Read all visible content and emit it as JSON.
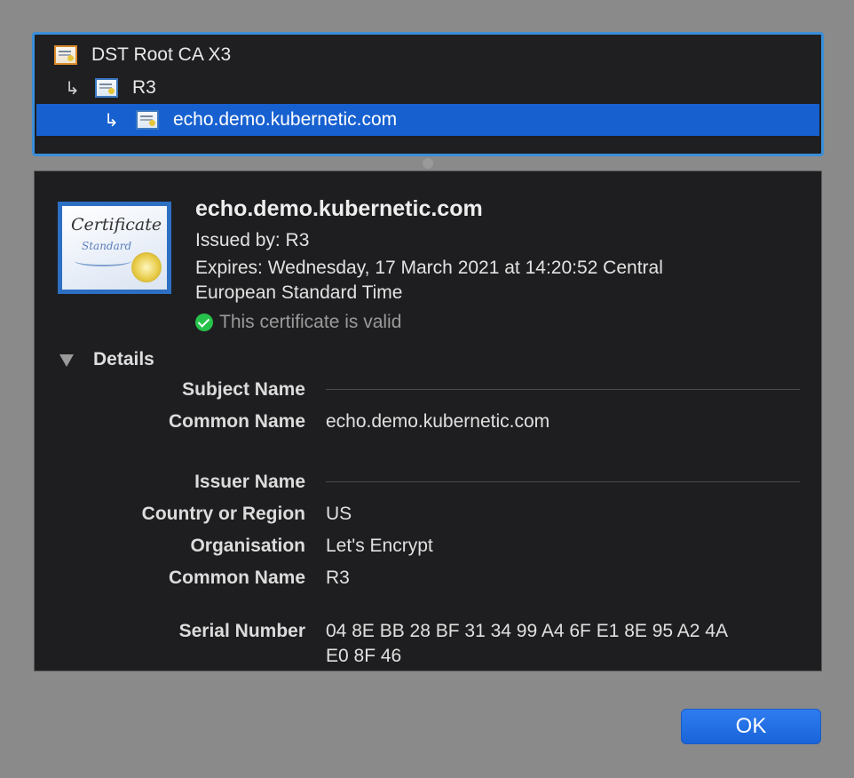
{
  "chain": {
    "items": [
      {
        "label": "DST Root CA X3",
        "icon": "root-certificate-icon"
      },
      {
        "label": "R3",
        "icon": "certificate-icon"
      },
      {
        "label": "echo.demo.kubernetic.com",
        "icon": "certificate-icon",
        "selected": true
      }
    ],
    "arrow": "↳"
  },
  "certificate": {
    "icon_title": "Certificate",
    "icon_subtitle": "Standard",
    "name": "echo.demo.kubernetic.com",
    "issued_by": "Issued by: R3",
    "expires_line1": "Expires: Wednesday, 17 March 2021 at 14:20:52 Central",
    "expires_line2": "European Standard Time",
    "status": "This certificate is valid"
  },
  "details": {
    "label": "Details",
    "subject_name_label": "Subject Name",
    "subject_common_name_label": "Common Name",
    "subject_common_name": "echo.demo.kubernetic.com",
    "issuer_name_label": "Issuer Name",
    "country_label": "Country or Region",
    "country": "US",
    "organisation_label": "Organisation",
    "organisation": "Let's Encrypt",
    "issuer_common_name_label": "Common Name",
    "issuer_common_name": "R3",
    "serial_label": "Serial Number",
    "serial_line1": "04 8E BB 28 BF 31 34 99 A4 6F E1 8E 95 A2 4A",
    "serial_line2": "E0 8F 46"
  },
  "buttons": {
    "ok_label": "OK"
  },
  "colors": {
    "selection": "#1760d0",
    "focus_ring": "#3b8ed8",
    "valid": "#27c24b",
    "button": "#1f6fe6"
  }
}
